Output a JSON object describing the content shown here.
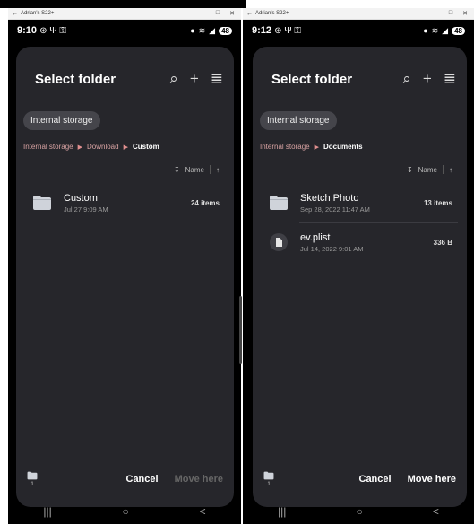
{
  "left": {
    "window_title": "Adrian's S22+",
    "time": "9:10",
    "status_glyphs": "⊛ Ψ ⚿",
    "battery": "48",
    "dialog_title": "Select folder",
    "storage_chip": "Internal storage",
    "breadcrumb": [
      {
        "label": "Internal storage"
      },
      {
        "label": "Download"
      },
      {
        "label": "Custom"
      }
    ],
    "sort_label": "Name",
    "items": [
      {
        "name": "Custom",
        "date": "Jul 27 9:09 AM",
        "meta": "24 items",
        "type": "folder"
      }
    ],
    "bottom_count": "1",
    "cancel_label": "Cancel",
    "move_label": "Move here",
    "move_enabled": false
  },
  "right": {
    "window_title": "Adrian's S22+",
    "time": "9:12",
    "status_glyphs": "⊛ Ψ ⚿",
    "battery": "48",
    "dialog_title": "Select folder",
    "storage_chip": "Internal storage",
    "breadcrumb": [
      {
        "label": "Internal storage"
      },
      {
        "label": "Documents"
      }
    ],
    "sort_label": "Name",
    "items": [
      {
        "name": "Sketch Photo",
        "date": "Sep 28, 2022 11:47 AM",
        "meta": "13 items",
        "type": "folder"
      },
      {
        "name": "ev.plist",
        "date": "Jul 14, 2022 9:01 AM",
        "meta": "336 B",
        "type": "file"
      }
    ],
    "bottom_count": "1",
    "cancel_label": "Cancel",
    "move_label": "Move here",
    "move_enabled": true
  },
  "icons": {
    "back": "←",
    "minimize": "–",
    "maximize": "□",
    "close": "✕",
    "search": "⌕",
    "add": "+",
    "menu": "≣",
    "sort": "↧",
    "up": "↑",
    "nav_recent": "|||",
    "nav_home": "○",
    "nav_back": "<"
  },
  "colors": {
    "dialog_bg": "#26262b",
    "folder_icon": "#cfd3da",
    "breadcrumb": "#d9a3a3"
  }
}
